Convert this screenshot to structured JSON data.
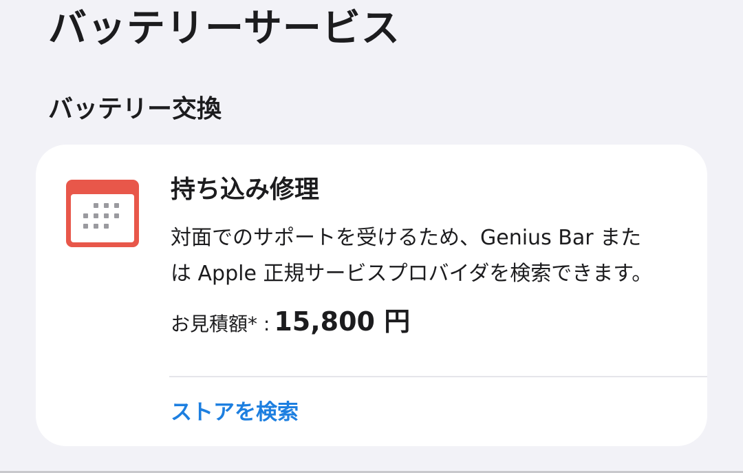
{
  "header": {
    "title": "バッテリーサービス"
  },
  "section": {
    "heading": "バッテリー交換"
  },
  "option": {
    "icon": "calendar-icon",
    "icon_color": "#e8574a",
    "title": "持ち込み修理",
    "description_line1": "対面でのサポートを受けるため、Genius Bar また",
    "description_line2": "は Apple 正規サービスプロバイダを検索できます。",
    "price_label": "お見積額* :",
    "price_value": "15,800 円",
    "link_label": "ストアを検索",
    "link_color": "#1d7fe0"
  }
}
